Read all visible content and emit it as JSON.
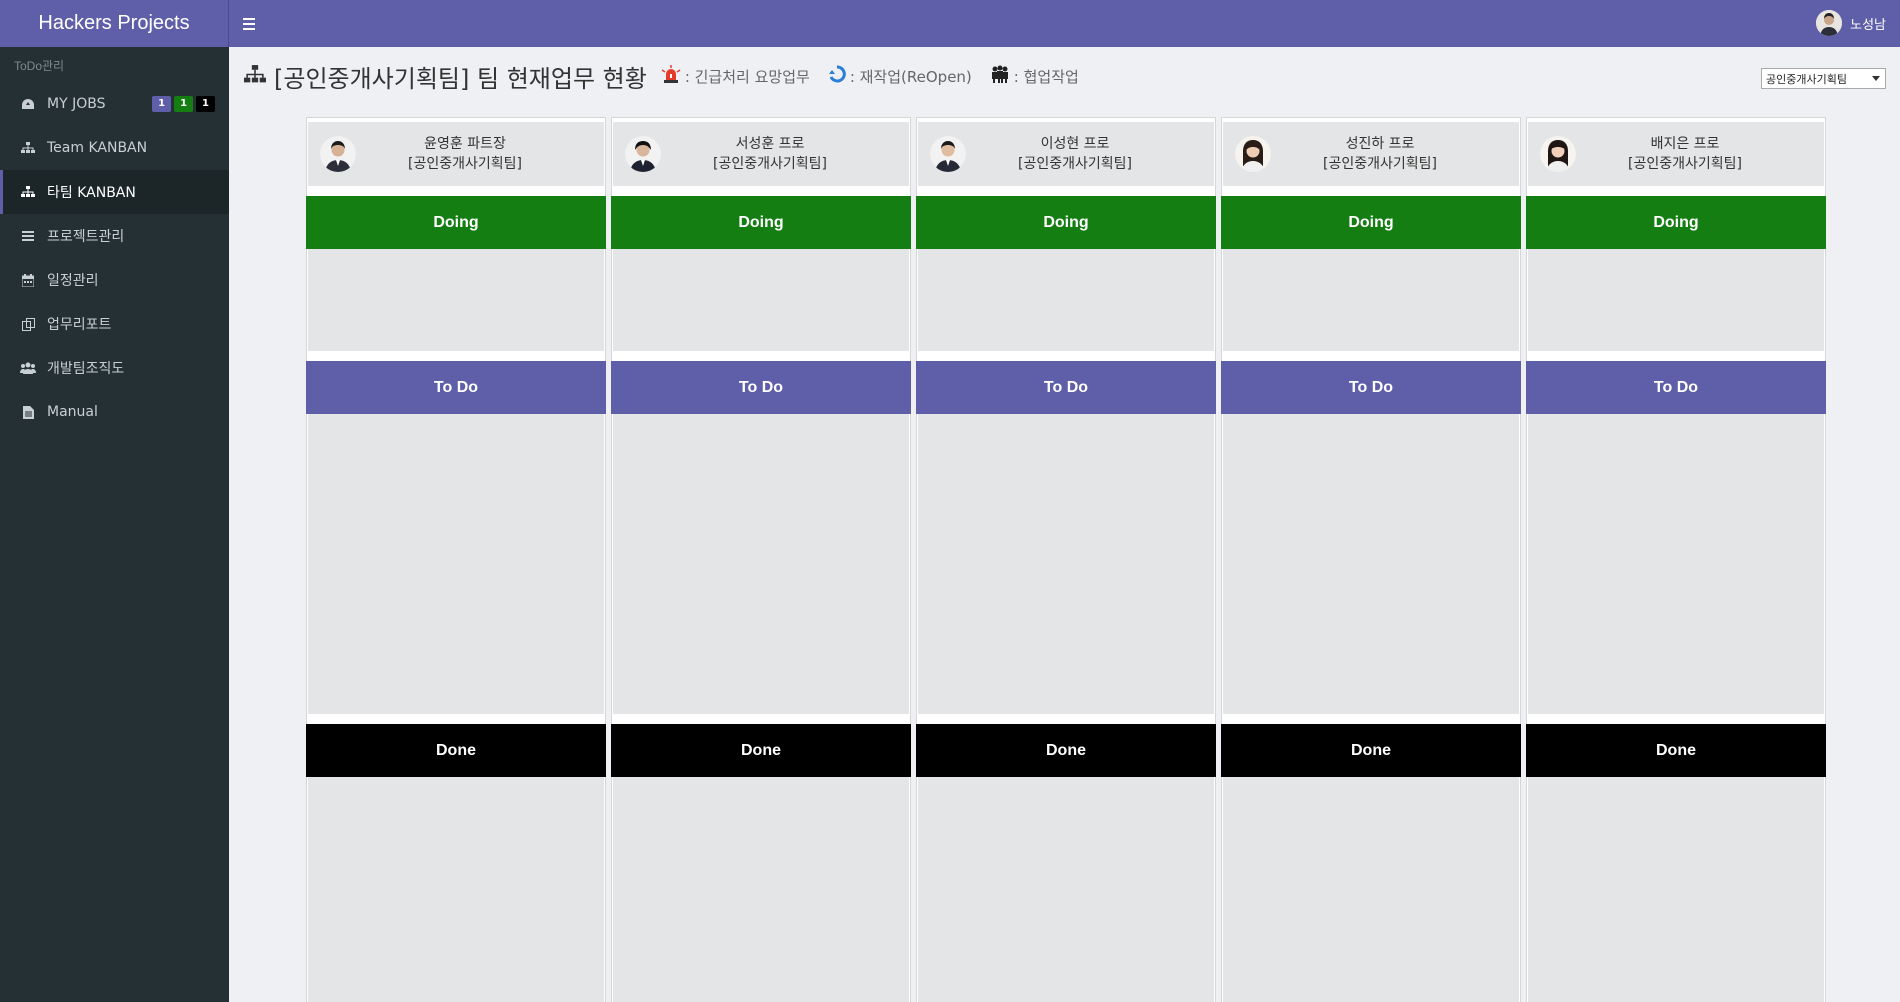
{
  "brand": "Hackers Projects",
  "sidebar": {
    "section_label": "ToDo관리",
    "items": [
      {
        "label": "MY JOBS",
        "icon": "dashboard-icon"
      },
      {
        "label": "Team KANBAN",
        "icon": "sitemap-icon"
      },
      {
        "label": "타팀 KANBAN",
        "icon": "sitemap-icon"
      },
      {
        "label": "프로젝트관리",
        "icon": "list-icon"
      },
      {
        "label": "일정관리",
        "icon": "calendar-icon"
      },
      {
        "label": "업무리포트",
        "icon": "copy-icon"
      },
      {
        "label": "개발팀조직도",
        "icon": "users-icon"
      },
      {
        "label": "Manual",
        "icon": "file-icon"
      }
    ],
    "badges": [
      {
        "value": "1",
        "color": "#5f5ea8"
      },
      {
        "value": "1",
        "color": "#157e13"
      },
      {
        "value": "1",
        "color": "#000000"
      }
    ]
  },
  "topbar": {
    "user_name": "노성남"
  },
  "header": {
    "title": "[공인중개사기획팀] 팀 현재업무 현황",
    "legend": [
      {
        "label": ": 긴급처리 요망업무",
        "icon": "siren-icon"
      },
      {
        "label": ": 재작업(ReOpen)",
        "icon": "reopen-icon"
      },
      {
        "label": ": 협업작업",
        "icon": "collab-icon"
      }
    ],
    "team_select": "공인중개사기획팀"
  },
  "lanes": {
    "doing": "Doing",
    "todo": "To Do",
    "done": "Done"
  },
  "members": [
    {
      "name": "윤영훈 파트장",
      "team": "[공인중개사기획팀]"
    },
    {
      "name": "서성훈 프로",
      "team": "[공인중개사기획팀]"
    },
    {
      "name": "이성현 프로",
      "team": "[공인중개사기획팀]"
    },
    {
      "name": "성진하 프로",
      "team": "[공인중개사기획팀]"
    },
    {
      "name": "배지은 프로",
      "team": "[공인중개사기획팀]"
    }
  ],
  "colors": {
    "accent": "#5f5ea8",
    "doing": "#157e13",
    "done": "#000000",
    "sidebar": "#243034"
  }
}
